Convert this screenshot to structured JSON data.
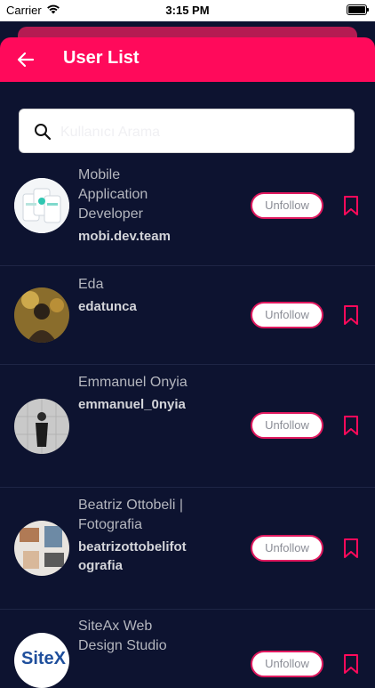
{
  "status_bar": {
    "carrier": "Carrier",
    "time": "3:15 PM"
  },
  "header": {
    "title": "User List",
    "back_icon": "arrow-left-icon"
  },
  "search": {
    "placeholder": "Kullanıcı Arama",
    "value": ""
  },
  "colors": {
    "accent": "#ff0a5b",
    "background": "#0d1330",
    "button_border": "#e0195f"
  },
  "users": [
    {
      "name": "Mobile Application Developer",
      "username": "mobi.dev.team",
      "button": "Unfollow",
      "avatar": "app-mockup-image"
    },
    {
      "name": "Eda",
      "username": "edatunca",
      "button": "Unfollow",
      "avatar": "person-photo"
    },
    {
      "name": "Emmanuel Onyia",
      "username": "emmanuel_0nyia",
      "button": "Unfollow",
      "avatar": "person-photo"
    },
    {
      "name": "Beatriz Ottobeli | Fotografia",
      "username": "beatrizottobelifotografia",
      "button": "Unfollow",
      "avatar": "photography-image"
    },
    {
      "name": "SiteAx Web Design Studio",
      "username": "",
      "button": "Unfollow",
      "avatar": "siteax-logo",
      "logo_text": "SiteX"
    }
  ]
}
